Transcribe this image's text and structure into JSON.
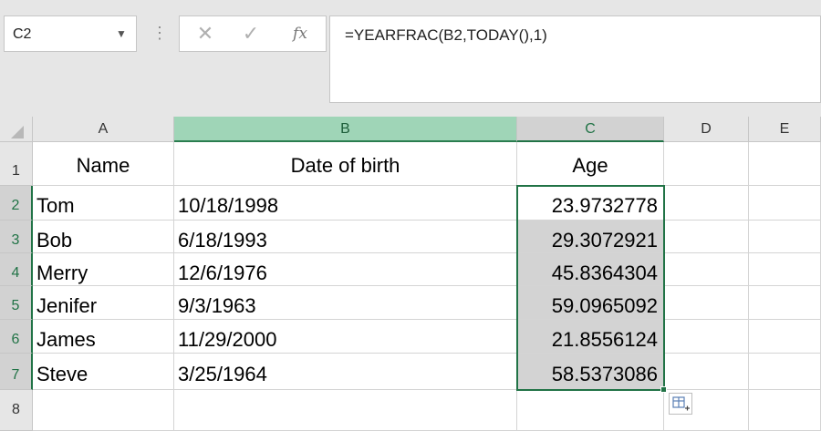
{
  "name_box": "C2",
  "formula_bar": {
    "cancel_glyph": "✕",
    "enter_glyph": "✓",
    "fx_label": "fx",
    "formula": "=YEARFRAC(B2,TODAY(),1)"
  },
  "columns": [
    "A",
    "B",
    "C",
    "D",
    "E"
  ],
  "rows": [
    "1",
    "2",
    "3",
    "4",
    "5",
    "6",
    "7",
    "8"
  ],
  "headers": {
    "A": "Name",
    "B": "Date of birth",
    "C": "Age"
  },
  "data": [
    {
      "name": "Tom",
      "dob": "10/18/1998",
      "age": "23.9732778"
    },
    {
      "name": "Bob",
      "dob": "6/18/1993",
      "age": "29.3072921"
    },
    {
      "name": "Merry",
      "dob": "12/6/1976",
      "age": "45.8364304"
    },
    {
      "name": "Jenifer",
      "dob": "9/3/1963",
      "age": "59.0965092"
    },
    {
      "name": "James",
      "dob": "11/29/2000",
      "age": "21.8556124"
    },
    {
      "name": "Steve",
      "dob": "3/25/1964",
      "age": "58.5373086"
    }
  ],
  "colors": {
    "selection": "#217346",
    "column_b_highlight": "#9fd5b7",
    "shaded_cells": "#d3d3d3"
  }
}
